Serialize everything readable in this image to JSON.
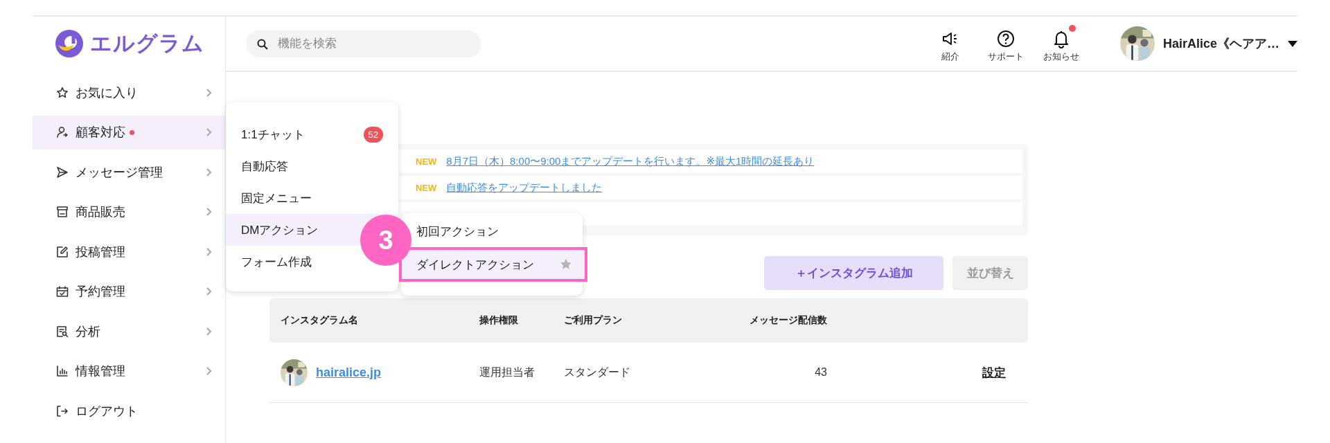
{
  "logo": {
    "text": "エルグラム"
  },
  "search": {
    "placeholder": "機能を検索"
  },
  "header_actions": [
    {
      "label": "紹介",
      "unread": false
    },
    {
      "label": "サポート",
      "unread": false
    },
    {
      "label": "お知らせ",
      "unread": true
    }
  ],
  "account": {
    "name": "HairAlice《ヘアア…"
  },
  "sidebar": {
    "items": [
      {
        "label": "お気に入り",
        "selected": false,
        "alert": false
      },
      {
        "label": "顧客対応",
        "selected": true,
        "alert": true
      },
      {
        "label": "メッセージ管理",
        "selected": false,
        "alert": false
      },
      {
        "label": "商品販売",
        "selected": false,
        "alert": false
      },
      {
        "label": "投稿管理",
        "selected": false,
        "alert": false
      },
      {
        "label": "予約管理",
        "selected": false,
        "alert": false
      },
      {
        "label": "分析",
        "selected": false,
        "alert": false
      },
      {
        "label": "情報管理",
        "selected": false,
        "alert": false
      },
      {
        "label": "ログアウト",
        "selected": false,
        "alert": false,
        "kind": "plain"
      }
    ]
  },
  "submenu": {
    "items": [
      {
        "label": "1:1チャット",
        "selected": false,
        "badge": "52"
      },
      {
        "label": "自動応答",
        "selected": false
      },
      {
        "label": "固定メニュー",
        "selected": false
      },
      {
        "label": "DMアクション",
        "selected": true
      },
      {
        "label": "フォーム作成",
        "selected": false
      }
    ]
  },
  "submenu_2": {
    "items": [
      {
        "label": "初回アクション",
        "selected": false
      },
      {
        "label": "ダイレクトアクション",
        "selected": true
      }
    ]
  },
  "step_marker": {
    "text": "3"
  },
  "notices": [
    {
      "tag": "NEW",
      "text": "8月7日（木）8:00〜9:00までアップデートを行います。※最大1時間の延長あり"
    },
    {
      "tag": "NEW",
      "text": "自動応答をアップデートしました"
    }
  ],
  "buttons": [
    {
      "label": "＋インスタグラム追加",
      "kind": "primary",
      "disabled": false
    },
    {
      "label": "並び替え",
      "kind": "secondary",
      "disabled": true
    }
  ],
  "table": {
    "columns": [
      "インスタグラム名",
      "操作権限",
      "ご利用プラン",
      "メッセージ配信数"
    ],
    "rows": [
      {
        "name": "hairalice.jp",
        "role": "運用担当者",
        "plan": "スタンダード",
        "messages": "43",
        "action": "設定"
      }
    ]
  }
}
